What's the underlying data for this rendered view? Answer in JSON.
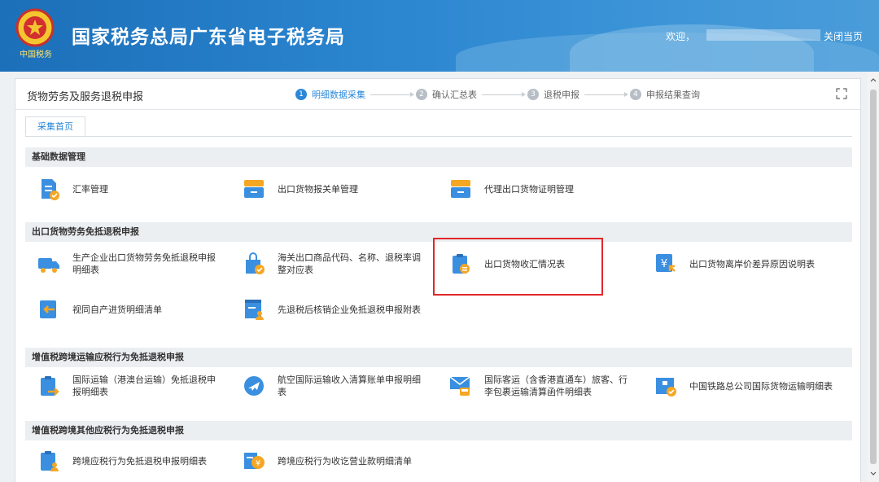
{
  "header": {
    "motto": "中国税务",
    "site_title": "国家税务总局广东省电子税务局",
    "welcome": "欢迎，",
    "close_label": "关闭当页"
  },
  "panel": {
    "title": "货物劳务及服务退税申报",
    "steps": [
      {
        "num": "1",
        "label": "明细数据采集"
      },
      {
        "num": "2",
        "label": "确认汇总表"
      },
      {
        "num": "3",
        "label": "退税申报"
      },
      {
        "num": "4",
        "label": "申报结果查询"
      }
    ],
    "tab": "采集首页"
  },
  "sections": [
    {
      "title": "基础数据管理",
      "items": [
        "汇率管理",
        "出口货物报关单管理",
        "代理出口货物证明管理"
      ]
    },
    {
      "title": "出口货物劳务免抵退税申报",
      "items": [
        "生产企业出口货物劳务免抵退税申报明细表",
        "海关出口商品代码、名称、退税率调整对应表",
        "出口货物收汇情况表",
        "出口货物离岸价差异原因说明表",
        "视同自产进货明细清单",
        "先退税后核销企业免抵退税申报附表"
      ]
    },
    {
      "title": "增值税跨境运输应税行为免抵退税申报",
      "items": [
        "国际运输（港澳台运输）免抵退税申报明细表",
        "航空国际运输收入清算账单申报明细表",
        "国际客运（含香港直通车）旅客、行李包裹运输清算函件明细表",
        "中国铁路总公司国际货物运输明细表"
      ]
    },
    {
      "title": "增值税跨境其他应税行为免抵退税申报",
      "items": [
        "跨境应税行为免抵退税申报明细表",
        "跨境应税行为收讫营业款明细清单"
      ]
    }
  ],
  "colors": {
    "accent": "#2b87d8",
    "icon_blue": "#3a8fe0",
    "icon_orange": "#f5a623",
    "highlight": "#e0272b"
  }
}
